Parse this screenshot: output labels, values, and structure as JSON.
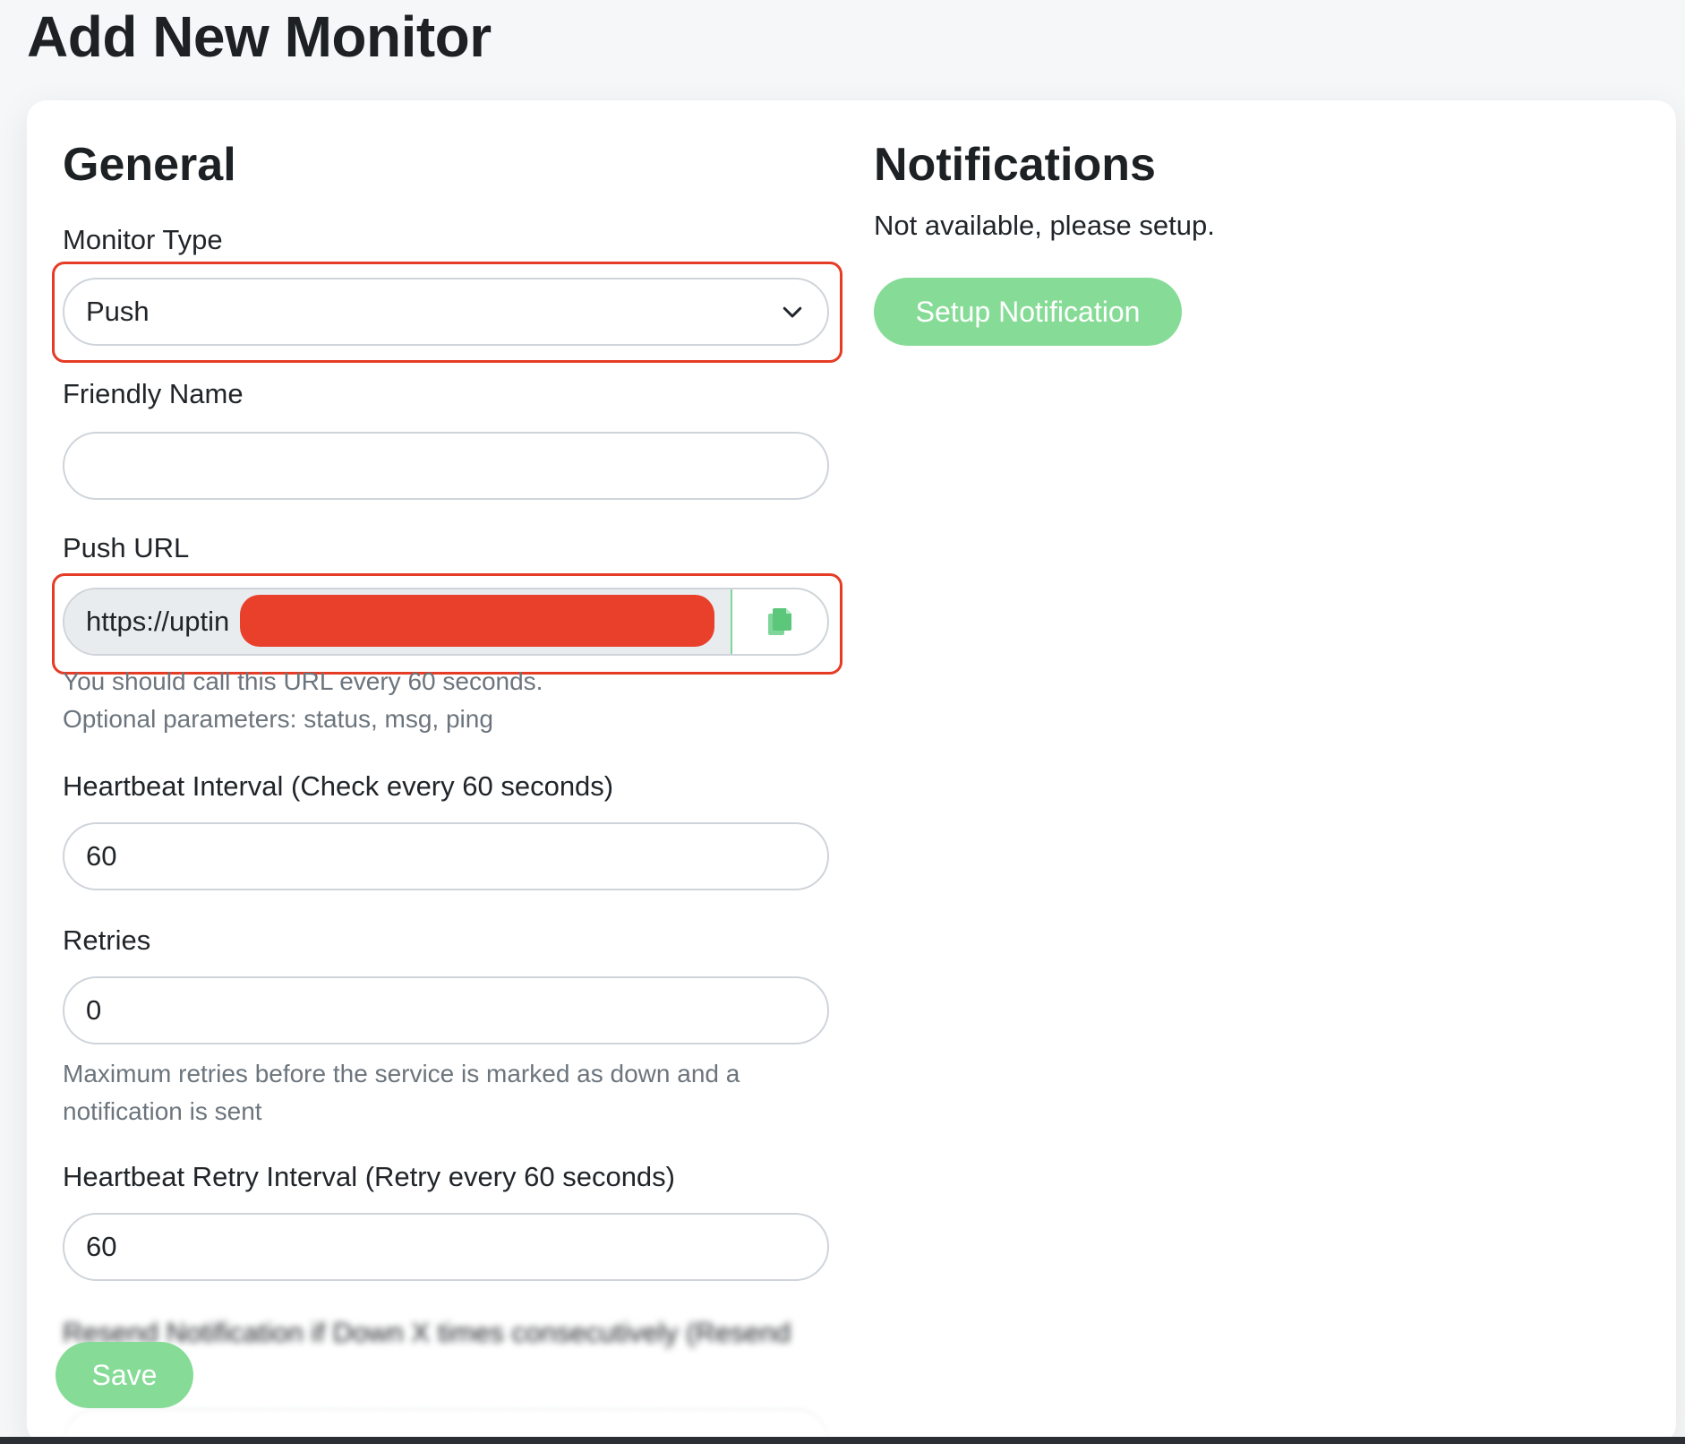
{
  "page": {
    "title": "Add New Monitor"
  },
  "general": {
    "section_title": "General",
    "monitor_type": {
      "label": "Monitor Type",
      "value": "Push"
    },
    "friendly_name": {
      "label": "Friendly Name",
      "value": ""
    },
    "push_url": {
      "label": "Push URL",
      "value": "https://uptin",
      "help_line1": "You should call this URL every 60 seconds.",
      "help_line2": "Optional parameters: status, msg, ping"
    },
    "heartbeat_interval": {
      "label": "Heartbeat Interval (Check every 60 seconds)",
      "value": "60"
    },
    "retries": {
      "label": "Retries",
      "value": "0",
      "help": "Maximum retries before the service is marked as down and a notification is sent"
    },
    "retry_interval": {
      "label": "Heartbeat Retry Interval (Retry every 60 seconds)",
      "value": "60"
    },
    "resend": {
      "label": "Resend Notification if Down X times consecutively (Resend"
    },
    "save_label": "Save"
  },
  "notifications": {
    "section_title": "Notifications",
    "empty_text": "Not available, please setup.",
    "setup_label": "Setup Notification"
  },
  "colors": {
    "accent_green": "#86dc97",
    "highlight_red": "#e53c26",
    "redaction_red": "#e8402a"
  },
  "icons": {
    "select_chevron": "chevron-down-icon",
    "copy": "copy-icon"
  }
}
